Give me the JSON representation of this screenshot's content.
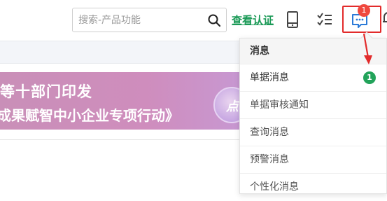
{
  "header": {
    "search": {
      "placeholder": "搜索-产品功能",
      "value": ""
    },
    "verify_link": "查看认证",
    "message_count": "1",
    "icons": {
      "search": "search-icon",
      "mobile": "mobile-icon",
      "tasks": "task-list-icon",
      "messages": "message-icon",
      "notifications": "bell-icon"
    }
  },
  "banner": {
    "line1": "等十部门印发",
    "line2": "成果赋智中小企业专项行动》",
    "circle_text": "点"
  },
  "message_menu": {
    "title": "消息",
    "items": [
      {
        "label": "单据消息",
        "badge": "1"
      },
      {
        "label": "单据审核通知"
      },
      {
        "label": "查询消息"
      },
      {
        "label": "预警消息"
      },
      {
        "label": "个性化消息"
      }
    ]
  },
  "colors": {
    "accent_green": "#1b9a57",
    "badge_red": "#f0483e",
    "highlight_red": "#e22b2b",
    "badge_green": "#22a35a"
  }
}
